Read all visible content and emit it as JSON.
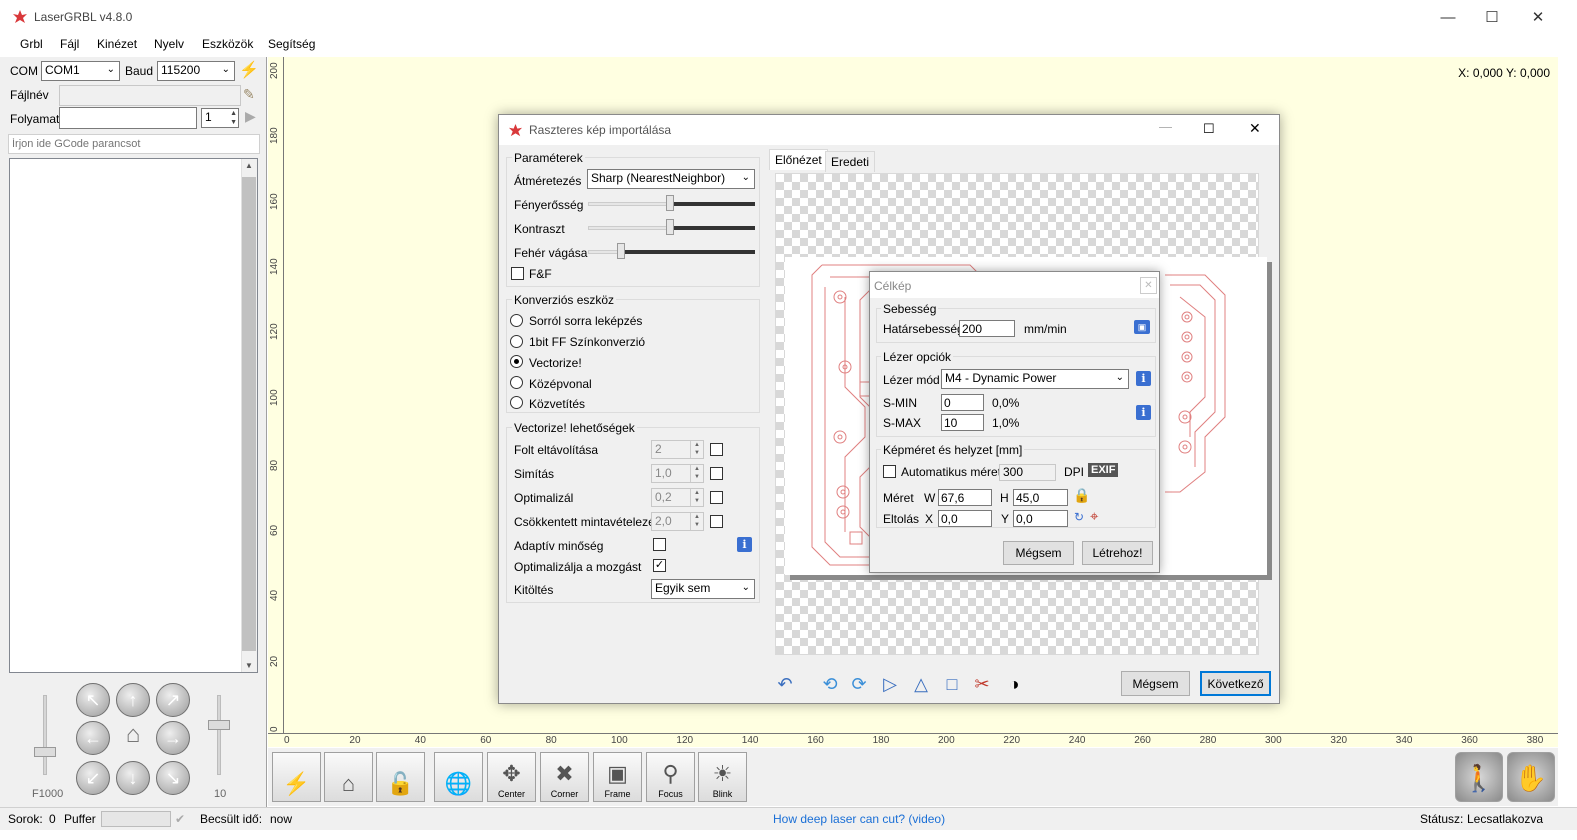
{
  "app": {
    "title": "LaserGRBL v4.8.0"
  },
  "menu": [
    "Grbl",
    "Fájl",
    "Kinézet",
    "Nyelv",
    "Eszközök",
    "Segítség"
  ],
  "left": {
    "com_label": "COM",
    "com_value": "COM1",
    "baud_label": "Baud",
    "baud_value": "115200",
    "filename_label": "Fájlnév",
    "progress_label": "Folyamat",
    "progress_count": "1",
    "gcode_placeholder": "Írjon ide GCode parancsot",
    "speed_label": "F1000",
    "step_label": "10"
  },
  "canvas": {
    "coords": "X: 0,000 Y: 0,000",
    "vticks": [
      "200",
      "180",
      "160",
      "140",
      "120",
      "100",
      "80",
      "60",
      "40",
      "20",
      "0"
    ],
    "hticks": [
      "0",
      "20",
      "40",
      "60",
      "80",
      "100",
      "120",
      "140",
      "160",
      "180",
      "200",
      "220",
      "240",
      "260",
      "280",
      "300",
      "320",
      "340",
      "360",
      "380"
    ]
  },
  "toolbar": {
    "center": "Center",
    "corner": "Corner",
    "frame": "Frame",
    "focus": "Focus",
    "blink": "Blink"
  },
  "status": {
    "rows_label": "Sorok:",
    "rows_value": "0",
    "buffer_label": "Puffer",
    "est_label": "Becsült idő:",
    "est_value": "now",
    "link": "How deep laser can cut? (video)",
    "status_label": "Státusz:",
    "status_value": "Lecsatlakozva"
  },
  "dlg1": {
    "title": "Raszteres kép importálása",
    "params_group": "Paraméterek",
    "resize_label": "Átméretezés",
    "resize_value": "Sharp (NearestNeighbor)",
    "brightness_label": "Fényerősség",
    "contrast_label": "Kontraszt",
    "white_label": "Fehér vágása",
    "ff_label": "F&F",
    "conv_group": "Konverziós eszköz",
    "conv_options": [
      "Sorról sorra leképzés",
      "1bit FF Színkonverzió",
      "Vectorize!",
      "Középvonal",
      "Közvetítés"
    ],
    "vec_group": "Vectorize! lehetőségek",
    "spot_label": "Folt eltávolítása",
    "spot_value": "2",
    "smooth_label": "Simítás",
    "smooth_value": "1,0",
    "optimize_label": "Optimalizál",
    "optimize_value": "0,2",
    "downsample_label": "Csökkentett mintavételezés",
    "downsample_value": "2,0",
    "adaptive_label": "Adaptív minőség",
    "optmove_label": "Optimalizálja a mozgást",
    "fill_label": "Kitöltés",
    "fill_value": "Egyik sem",
    "tab_preview": "Előnézet",
    "tab_original": "Eredeti",
    "cancel": "Mégsem",
    "next": "Következő"
  },
  "dlg2": {
    "title": "Célkép",
    "speed_group": "Sebesség",
    "border_speed_label": "Határsebesség",
    "border_speed_value": "200",
    "speed_unit": "mm/min",
    "laser_group": "Lézer opciók",
    "mode_label": "Lézer mód",
    "mode_value": "M4 - Dynamic Power",
    "smin_label": "S-MIN",
    "smin_value": "0",
    "smin_pct": "0,0%",
    "smax_label": "S-MAX",
    "smax_value": "10",
    "smax_pct": "1,0%",
    "size_group": "Képméret és helyzet [mm]",
    "auto_label": "Automatikus méret",
    "dpi_value": "300",
    "dpi_label": "DPI",
    "exif": "EXIF",
    "size_label": "Méret",
    "w_label": "W",
    "w_value": "67,6",
    "h_label": "H",
    "h_value": "45,0",
    "offset_label": "Eltolás",
    "x_label": "X",
    "x_value": "0,0",
    "y_label": "Y",
    "y_value": "0,0",
    "cancel": "Mégsem",
    "create": "Létrehoz!"
  }
}
